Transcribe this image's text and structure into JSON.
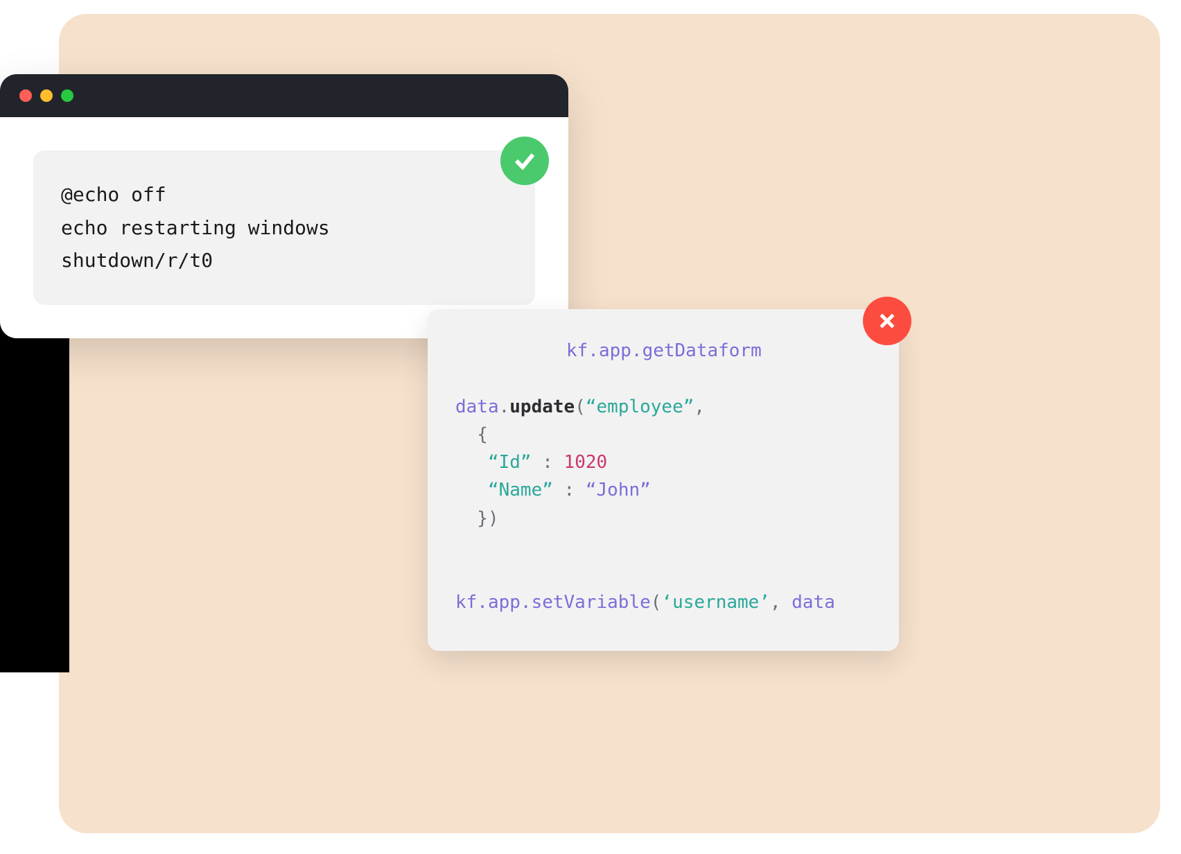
{
  "colors": {
    "background_card": "#f6e1cc",
    "terminal_titlebar": "#21252b",
    "code_block": "#f2f2f2",
    "check_badge": "#4ac96d",
    "close_badge": "#fc4c3f",
    "traffic_red": "#ff5f56",
    "traffic_yellow": "#ffbd2e",
    "traffic_green": "#27c93f"
  },
  "terminal": {
    "code": {
      "line1": "@echo off",
      "line2": "echo restarting windows",
      "line3": "shutdown/r/t0"
    }
  },
  "code_card": {
    "line1": {
      "part1": "kf.app.getDataform"
    },
    "line2": {
      "data": "data",
      "dot": ".",
      "update": "update",
      "open": "(",
      "employee": "“employee”",
      "close": ","
    },
    "line3": {
      "brace": "  {"
    },
    "line4": {
      "key": "   “Id”",
      "colon": " : ",
      "value": "1020"
    },
    "line5": {
      "key": "   “Name”",
      "colon": " : ",
      "value": "“John”"
    },
    "line6": {
      "brace": "  })"
    },
    "line7": {
      "prefix": "kf.app.setVariable",
      "open": "(",
      "arg1": "‘username’",
      "comma": ", ",
      "arg2": "data"
    }
  }
}
